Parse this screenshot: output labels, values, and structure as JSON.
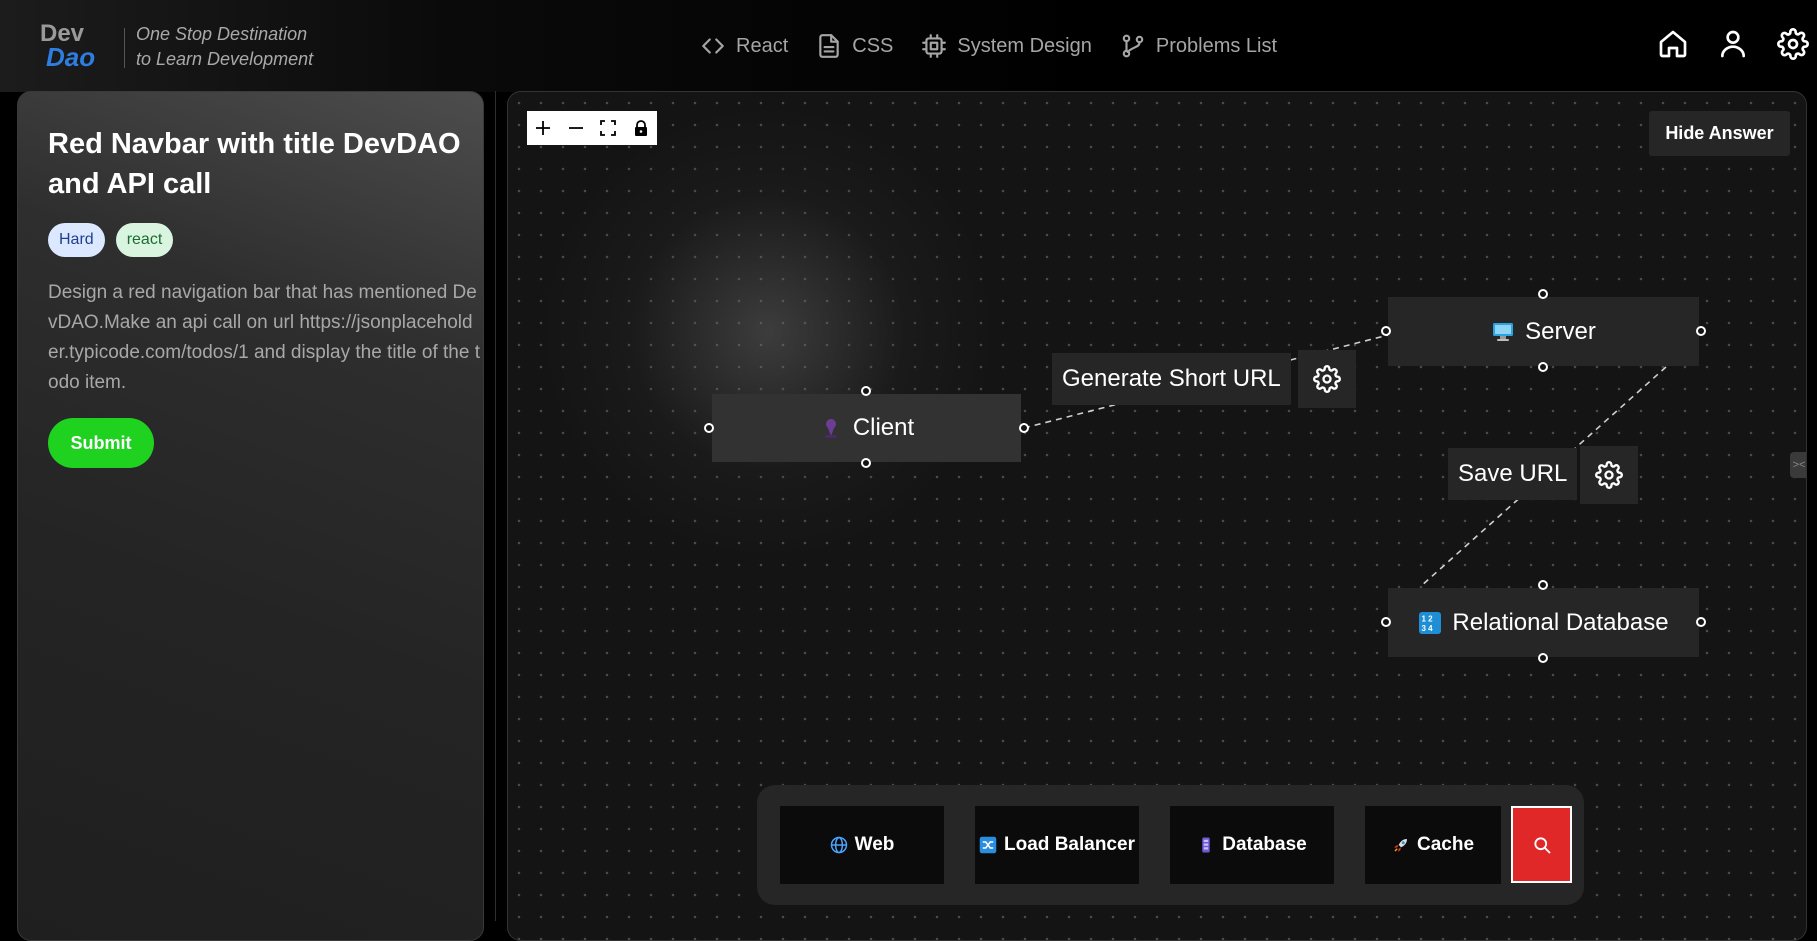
{
  "header": {
    "logo_text_top": "Dev",
    "logo_text_bottom": "Dao",
    "tagline_line1": "One Stop Destination",
    "tagline_line2": "to Learn Development",
    "nav": [
      {
        "label": "React",
        "icon": "code-icon"
      },
      {
        "label": "CSS",
        "icon": "file-icon"
      },
      {
        "label": "System Design",
        "icon": "chip-icon"
      },
      {
        "label": "Problems List",
        "icon": "git-branch-icon"
      }
    ],
    "icons": [
      "home-icon",
      "user-icon",
      "settings-icon"
    ]
  },
  "problem": {
    "title": "Red Navbar with title DevDAO and API call",
    "tags": {
      "difficulty": "Hard",
      "topic": "react"
    },
    "description": "Design a red navigation bar that has mentioned DevDAO.Make an api call on url https://jsonplaceholder.typicode.com/todos/1 and display the title of the todo item.",
    "submit_label": "Submit"
  },
  "canvas": {
    "hide_answer_label": "Hide Answer",
    "controls": [
      "zoom-in-icon",
      "zoom-out-icon",
      "fit-view-icon",
      "lock-icon"
    ],
    "nodes": {
      "client": {
        "label": "Client",
        "icon": "person-icon"
      },
      "server": {
        "label": "Server",
        "icon": "monitor-icon"
      },
      "database": {
        "label": "Relational Database",
        "icon": "numbers-icon"
      }
    },
    "edges": {
      "generate": {
        "label": "Generate Short URL"
      },
      "save": {
        "label": "Save URL"
      }
    },
    "side_tab_label": "><"
  },
  "palette": {
    "items": [
      {
        "label": "Web",
        "icon": "globe-icon"
      },
      {
        "label": "Load Balancer",
        "icon": "shuffle-icon"
      },
      {
        "label": "Database",
        "icon": "database-icon"
      },
      {
        "label": "Cache",
        "icon": "rocket-icon"
      }
    ],
    "search_icon": "search-icon"
  },
  "colors": {
    "submit": "#1fd21f",
    "search_button": "#e02828",
    "logo_blue": "#2f7de1"
  }
}
